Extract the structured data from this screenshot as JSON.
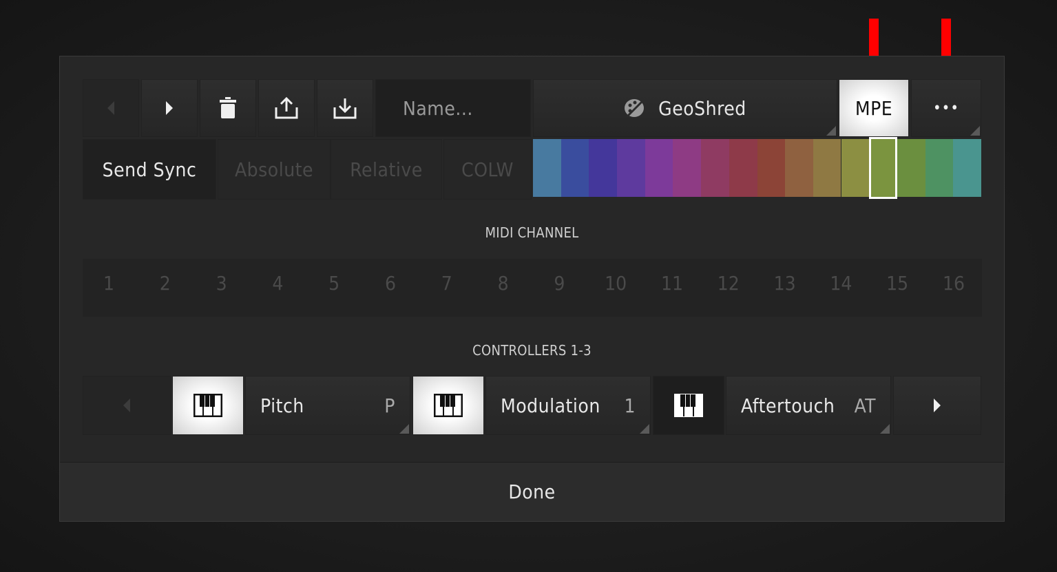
{
  "toolbar": {
    "name_placeholder": "Name...",
    "preset_name": "GeoShred",
    "mpe_label": "MPE",
    "more_label": "•••"
  },
  "sync_row": {
    "send_sync": "Send Sync",
    "absolute": "Absolute",
    "relative": "Relative",
    "colw": "COLW"
  },
  "colors": {
    "swatches": [
      "#487aa0",
      "#3a4d9e",
      "#44379b",
      "#5e3a9e",
      "#7d3a9a",
      "#8e3b84",
      "#8f3b62",
      "#8e3a49",
      "#8c4437",
      "#8f6140",
      "#8f7943",
      "#8c8f42",
      "#7b943f",
      "#6b8f3f",
      "#4e9262",
      "#4a958f"
    ],
    "selected_index": 12,
    "accent_arrow": "#ff0000"
  },
  "midi": {
    "title": "MIDI CHANNEL",
    "channels": [
      "1",
      "2",
      "3",
      "4",
      "5",
      "6",
      "7",
      "8",
      "9",
      "10",
      "11",
      "12",
      "13",
      "14",
      "15",
      "16"
    ]
  },
  "controllers": {
    "title": "CONTROLLERS 1-3",
    "items": [
      {
        "name": "Pitch",
        "code": "P"
      },
      {
        "name": "Modulation",
        "code": "1"
      },
      {
        "name": "Aftertouch",
        "code": "AT"
      }
    ]
  },
  "footer": {
    "done_label": "Done"
  }
}
